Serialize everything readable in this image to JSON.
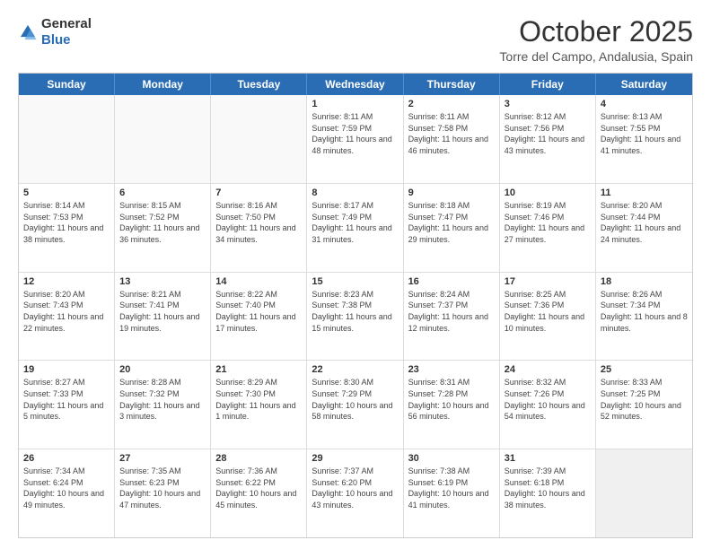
{
  "header": {
    "logo_general": "General",
    "logo_blue": "Blue",
    "month_title": "October 2025",
    "location": "Torre del Campo, Andalusia, Spain"
  },
  "days_of_week": [
    "Sunday",
    "Monday",
    "Tuesday",
    "Wednesday",
    "Thursday",
    "Friday",
    "Saturday"
  ],
  "rows": [
    [
      {
        "day": "",
        "text": "",
        "empty": true
      },
      {
        "day": "",
        "text": "",
        "empty": true
      },
      {
        "day": "",
        "text": "",
        "empty": true
      },
      {
        "day": "1",
        "text": "Sunrise: 8:11 AM\nSunset: 7:59 PM\nDaylight: 11 hours and 48 minutes."
      },
      {
        "day": "2",
        "text": "Sunrise: 8:11 AM\nSunset: 7:58 PM\nDaylight: 11 hours and 46 minutes."
      },
      {
        "day": "3",
        "text": "Sunrise: 8:12 AM\nSunset: 7:56 PM\nDaylight: 11 hours and 43 minutes."
      },
      {
        "day": "4",
        "text": "Sunrise: 8:13 AM\nSunset: 7:55 PM\nDaylight: 11 hours and 41 minutes."
      }
    ],
    [
      {
        "day": "5",
        "text": "Sunrise: 8:14 AM\nSunset: 7:53 PM\nDaylight: 11 hours and 38 minutes."
      },
      {
        "day": "6",
        "text": "Sunrise: 8:15 AM\nSunset: 7:52 PM\nDaylight: 11 hours and 36 minutes."
      },
      {
        "day": "7",
        "text": "Sunrise: 8:16 AM\nSunset: 7:50 PM\nDaylight: 11 hours and 34 minutes."
      },
      {
        "day": "8",
        "text": "Sunrise: 8:17 AM\nSunset: 7:49 PM\nDaylight: 11 hours and 31 minutes."
      },
      {
        "day": "9",
        "text": "Sunrise: 8:18 AM\nSunset: 7:47 PM\nDaylight: 11 hours and 29 minutes."
      },
      {
        "day": "10",
        "text": "Sunrise: 8:19 AM\nSunset: 7:46 PM\nDaylight: 11 hours and 27 minutes."
      },
      {
        "day": "11",
        "text": "Sunrise: 8:20 AM\nSunset: 7:44 PM\nDaylight: 11 hours and 24 minutes."
      }
    ],
    [
      {
        "day": "12",
        "text": "Sunrise: 8:20 AM\nSunset: 7:43 PM\nDaylight: 11 hours and 22 minutes."
      },
      {
        "day": "13",
        "text": "Sunrise: 8:21 AM\nSunset: 7:41 PM\nDaylight: 11 hours and 19 minutes."
      },
      {
        "day": "14",
        "text": "Sunrise: 8:22 AM\nSunset: 7:40 PM\nDaylight: 11 hours and 17 minutes."
      },
      {
        "day": "15",
        "text": "Sunrise: 8:23 AM\nSunset: 7:38 PM\nDaylight: 11 hours and 15 minutes."
      },
      {
        "day": "16",
        "text": "Sunrise: 8:24 AM\nSunset: 7:37 PM\nDaylight: 11 hours and 12 minutes."
      },
      {
        "day": "17",
        "text": "Sunrise: 8:25 AM\nSunset: 7:36 PM\nDaylight: 11 hours and 10 minutes."
      },
      {
        "day": "18",
        "text": "Sunrise: 8:26 AM\nSunset: 7:34 PM\nDaylight: 11 hours and 8 minutes."
      }
    ],
    [
      {
        "day": "19",
        "text": "Sunrise: 8:27 AM\nSunset: 7:33 PM\nDaylight: 11 hours and 5 minutes."
      },
      {
        "day": "20",
        "text": "Sunrise: 8:28 AM\nSunset: 7:32 PM\nDaylight: 11 hours and 3 minutes."
      },
      {
        "day": "21",
        "text": "Sunrise: 8:29 AM\nSunset: 7:30 PM\nDaylight: 11 hours and 1 minute."
      },
      {
        "day": "22",
        "text": "Sunrise: 8:30 AM\nSunset: 7:29 PM\nDaylight: 10 hours and 58 minutes."
      },
      {
        "day": "23",
        "text": "Sunrise: 8:31 AM\nSunset: 7:28 PM\nDaylight: 10 hours and 56 minutes."
      },
      {
        "day": "24",
        "text": "Sunrise: 8:32 AM\nSunset: 7:26 PM\nDaylight: 10 hours and 54 minutes."
      },
      {
        "day": "25",
        "text": "Sunrise: 8:33 AM\nSunset: 7:25 PM\nDaylight: 10 hours and 52 minutes."
      }
    ],
    [
      {
        "day": "26",
        "text": "Sunrise: 7:34 AM\nSunset: 6:24 PM\nDaylight: 10 hours and 49 minutes."
      },
      {
        "day": "27",
        "text": "Sunrise: 7:35 AM\nSunset: 6:23 PM\nDaylight: 10 hours and 47 minutes."
      },
      {
        "day": "28",
        "text": "Sunrise: 7:36 AM\nSunset: 6:22 PM\nDaylight: 10 hours and 45 minutes."
      },
      {
        "day": "29",
        "text": "Sunrise: 7:37 AM\nSunset: 6:20 PM\nDaylight: 10 hours and 43 minutes."
      },
      {
        "day": "30",
        "text": "Sunrise: 7:38 AM\nSunset: 6:19 PM\nDaylight: 10 hours and 41 minutes."
      },
      {
        "day": "31",
        "text": "Sunrise: 7:39 AM\nSunset: 6:18 PM\nDaylight: 10 hours and 38 minutes."
      },
      {
        "day": "",
        "text": "",
        "empty": true,
        "shaded": true
      }
    ]
  ]
}
